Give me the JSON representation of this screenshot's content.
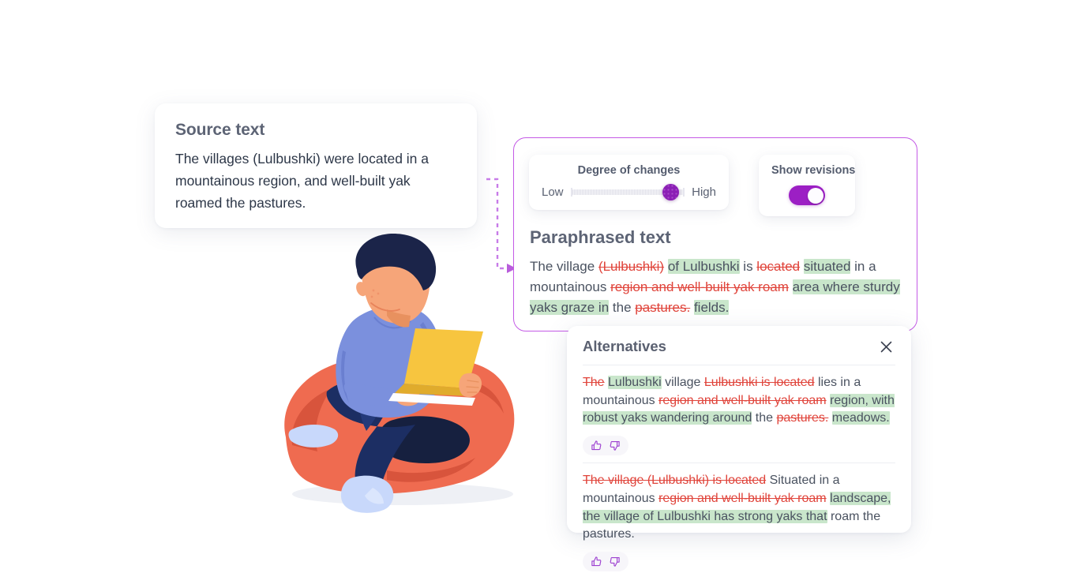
{
  "source": {
    "title": "Source text",
    "body": " The villages (Lulbushki) were located in a mountainous region, and well-built yak roamed the pastures."
  },
  "controls": {
    "degree": {
      "title": "Degree of changes",
      "low_label": "Low",
      "high_label": "High",
      "value_percent": 88
    },
    "show_revisions": {
      "title": "Show revisions",
      "enabled": true,
      "state_label": "on"
    }
  },
  "paraphrased": {
    "title": "Paraphrased text",
    "segments": [
      {
        "text": "The village ",
        "type": "plain"
      },
      {
        "text": "(Lulbushki)",
        "type": "del"
      },
      {
        "text": " ",
        "type": "plain"
      },
      {
        "text": "of Lulbushki",
        "type": "ins"
      },
      {
        "text": " is ",
        "type": "plain"
      },
      {
        "text": "located",
        "type": "del"
      },
      {
        "text": " ",
        "type": "plain"
      },
      {
        "text": "situated",
        "type": "ins"
      },
      {
        "text": " in a mountainous ",
        "type": "plain"
      },
      {
        "text": "region and well-built yak roam",
        "type": "del"
      },
      {
        "text": " ",
        "type": "plain"
      },
      {
        "text": "area where sturdy yaks graze in",
        "type": "ins"
      },
      {
        "text": " the ",
        "type": "plain"
      },
      {
        "text": "pastures.",
        "type": "del"
      },
      {
        "text": " ",
        "type": "plain"
      },
      {
        "text": "fields.",
        "type": "ins"
      }
    ]
  },
  "alternatives": {
    "title": "Alternatives",
    "close_icon": "close-icon",
    "items": [
      {
        "thumbs_up_icon": "thumbs-up-icon",
        "thumbs_down_icon": "thumbs-down-icon",
        "segments": [
          {
            "text": "The",
            "type": "del"
          },
          {
            "text": " ",
            "type": "plain"
          },
          {
            "text": "Lulbushki",
            "type": "ins"
          },
          {
            "text": " village ",
            "type": "plain"
          },
          {
            "text": "Lulbushki is located",
            "type": "del"
          },
          {
            "text": " lies in a mountainous ",
            "type": "plain"
          },
          {
            "text": "region and well-built yak roam",
            "type": "del"
          },
          {
            "text": " ",
            "type": "plain"
          },
          {
            "text": "region, with robust yaks wandering around",
            "type": "ins"
          },
          {
            "text": " the ",
            "type": "plain"
          },
          {
            "text": "pastures.",
            "type": "del"
          },
          {
            "text": " ",
            "type": "plain"
          },
          {
            "text": "meadows.",
            "type": "ins"
          }
        ]
      },
      {
        "thumbs_up_icon": "thumbs-up-icon",
        "thumbs_down_icon": "thumbs-down-icon",
        "segments": [
          {
            "text": "The village (Lulbushki) is located",
            "type": "del"
          },
          {
            "text": " Situated in a mountainous ",
            "type": "plain"
          },
          {
            "text": "region and well-built yak roam",
            "type": "del"
          },
          {
            "text": " ",
            "type": "plain"
          },
          {
            "text": "landscape, the village of Lulbushki has strong yaks that",
            "type": "ins"
          },
          {
            "text": " roam the pastures.",
            "type": "plain"
          }
        ]
      }
    ]
  },
  "illustration": {
    "name": "person-reading-laptop-on-beanbag",
    "colors": {
      "beanbag": "#ef6b50",
      "beanbag_shadow": "#d8543c",
      "sweater": "#7b90dd",
      "sweater_shade": "#6a7fd0",
      "pants": "#1c2e63",
      "pants_dark": "#16203f",
      "hair": "#1b2449",
      "skin": "#f6a579",
      "laptop": "#f7c53f",
      "laptop_shade": "#e0ab2c",
      "socks": "#c8d8fb",
      "floor_shadow": "#eef0f5"
    }
  },
  "theme": {
    "accent_purple": "#c45ae6",
    "slider_purple": "#8b1fb5",
    "toggle_purple": "#9c1fc4",
    "delete_red": "#e0443b",
    "insert_green_bg": "#c9e6cb",
    "heading_gray": "#5d6475",
    "body_gray": "#4a5260",
    "page_bg": "#ffffff"
  }
}
